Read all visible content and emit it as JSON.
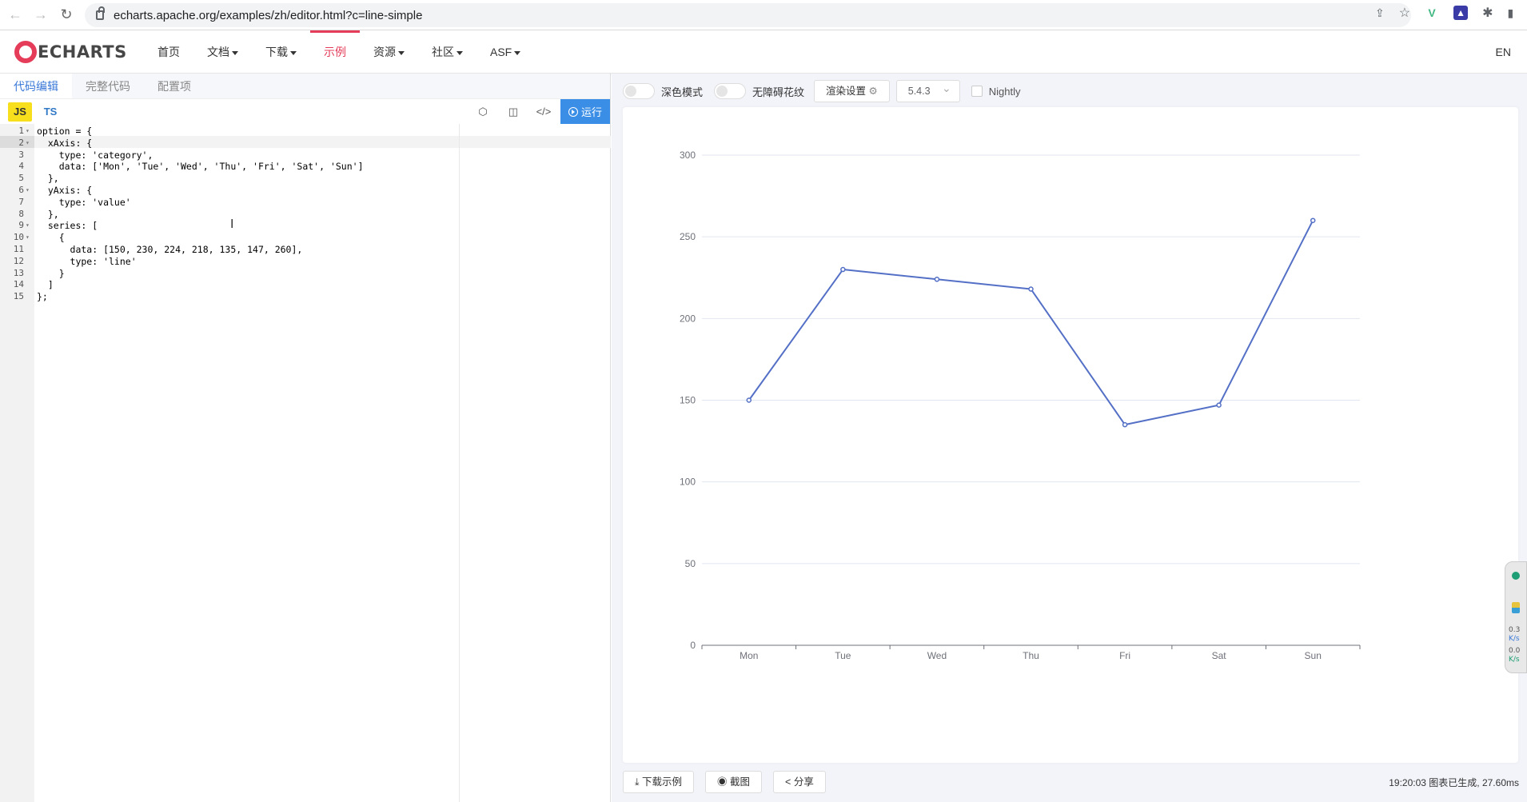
{
  "browser": {
    "url": "echarts.apache.org/examples/zh/editor.html?c=line-simple"
  },
  "header": {
    "logo_text": "ECHARTS",
    "nav": [
      {
        "label": "首页",
        "dropdown": false,
        "active": false
      },
      {
        "label": "文档",
        "dropdown": true,
        "active": false
      },
      {
        "label": "下载",
        "dropdown": true,
        "active": false
      },
      {
        "label": "示例",
        "dropdown": false,
        "active": true
      },
      {
        "label": "资源",
        "dropdown": true,
        "active": false
      },
      {
        "label": "社区",
        "dropdown": true,
        "active": false
      },
      {
        "label": "ASF",
        "dropdown": true,
        "active": false
      }
    ],
    "lang": "EN"
  },
  "editor": {
    "tabs": [
      "代码编辑",
      "完整代码",
      "配置项"
    ],
    "lang_js": "JS",
    "lang_ts": "TS",
    "run_label": "运行",
    "lines": [
      "option = {",
      "  xAxis: {",
      "    type: 'category',",
      "    data: ['Mon', 'Tue', 'Wed', 'Thu', 'Fri', 'Sat', 'Sun']",
      "  },",
      "  yAxis: {",
      "    type: 'value'",
      "  },",
      "  series: [",
      "    {",
      "      data: [150, 230, 224, 218, 135, 147, 260],",
      "      type: 'line'",
      "    }",
      "  ]",
      "};"
    ],
    "fold_lines": [
      1,
      2,
      6,
      9,
      10
    ]
  },
  "preview": {
    "dark_mode_label": "深色模式",
    "aria_label": "无障碍花纹",
    "render_settings": "渲染设置",
    "version": "5.4.3",
    "nightly": "Nightly",
    "download_btn": "下载示例",
    "screenshot_btn": "截图",
    "share_btn": "分享",
    "status": "19:20:03  图表已生成, 27.60ms"
  },
  "side_widget": {
    "up": "0.3",
    "up_unit": "K/s",
    "down": "0.0",
    "down_unit": "K/s"
  },
  "chart_data": {
    "type": "line",
    "categories": [
      "Mon",
      "Tue",
      "Wed",
      "Thu",
      "Fri",
      "Sat",
      "Sun"
    ],
    "values": [
      150,
      230,
      224,
      218,
      135,
      147,
      260
    ],
    "ylim": [
      0,
      300
    ],
    "yticks": [
      0,
      50,
      100,
      150,
      200,
      250,
      300
    ],
    "grid": true,
    "color": "#5470c6"
  }
}
